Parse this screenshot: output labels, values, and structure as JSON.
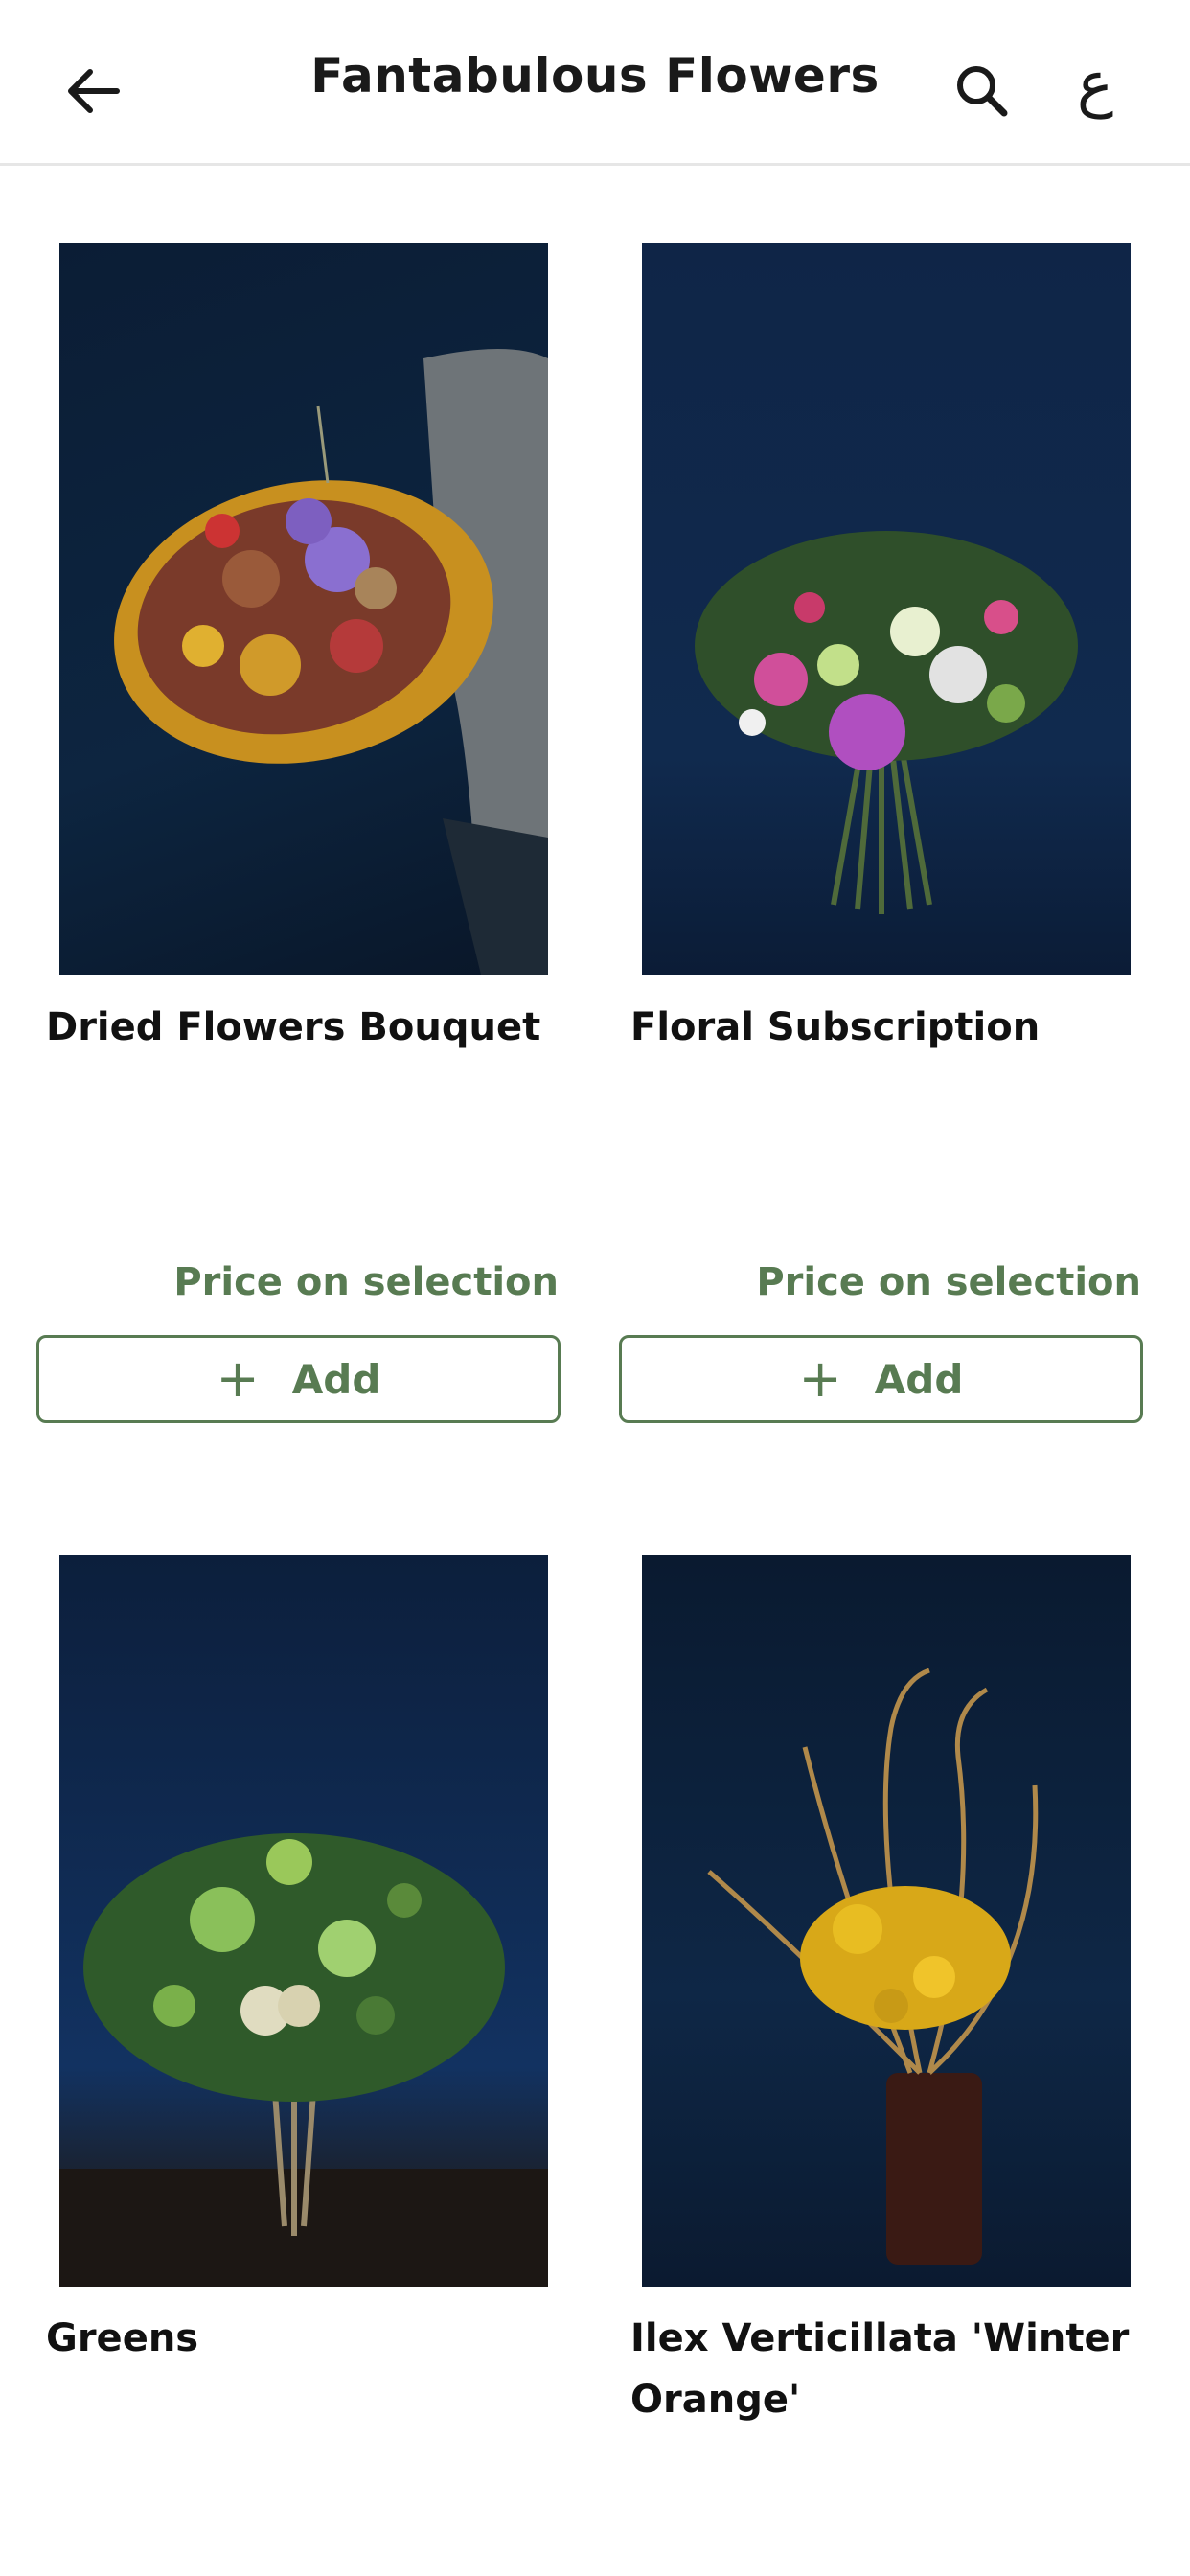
{
  "header": {
    "title": "Fantabulous Flowers",
    "back_icon": "arrow-left-icon",
    "search_icon": "search-icon",
    "language_toggle": "ع"
  },
  "colors": {
    "accent": "#587b52",
    "image_background": "#0d2140"
  },
  "products": [
    {
      "name": "Dried Flowers Bouquet",
      "price": "Price on selection",
      "add_label": "Add",
      "add_icon": "plus-icon"
    },
    {
      "name": "Floral Subscription",
      "price": "Price on selection",
      "add_label": "Add",
      "add_icon": "plus-icon"
    },
    {
      "name": "Greens"
    },
    {
      "name": "Ilex Verticillata 'Winter Orange'"
    }
  ]
}
